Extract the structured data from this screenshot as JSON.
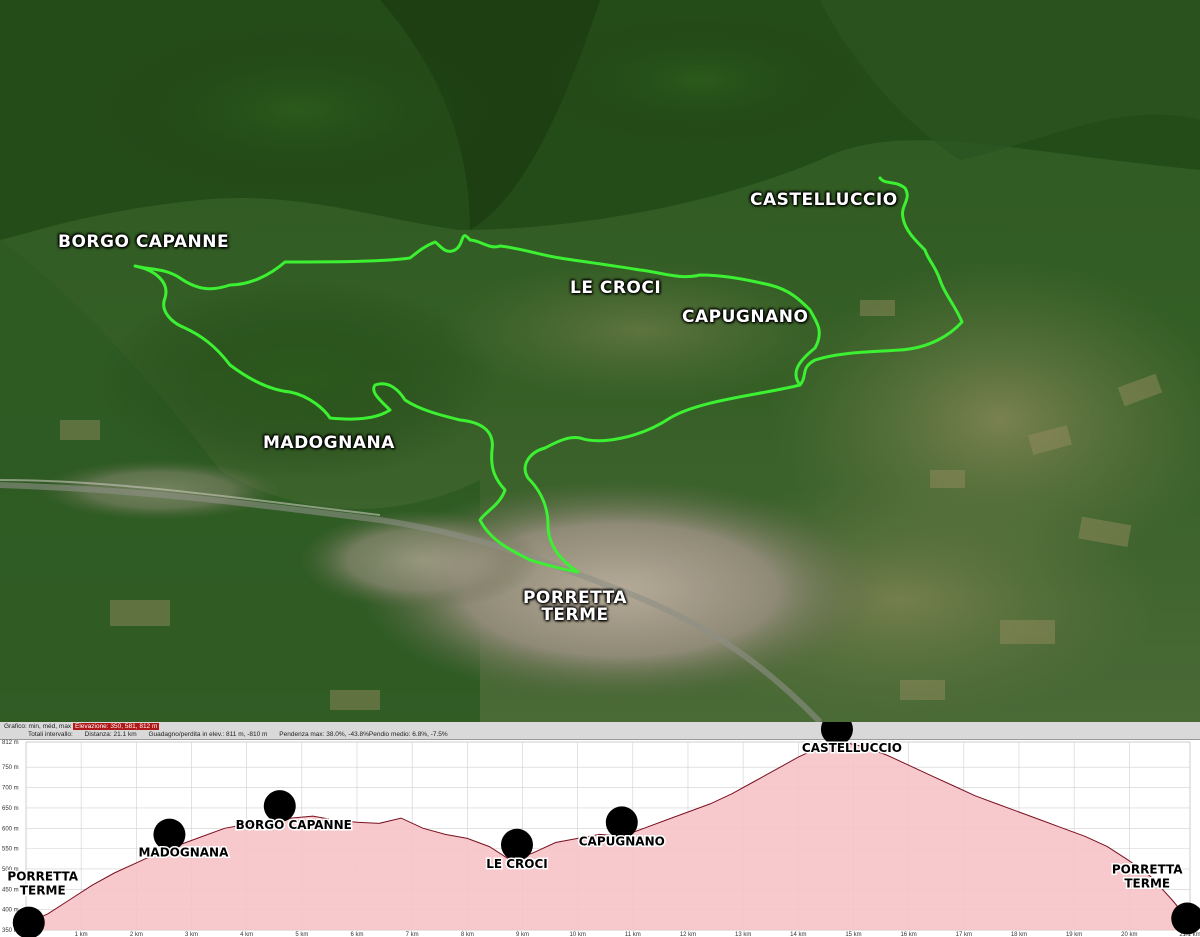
{
  "map": {
    "labels": {
      "borgo_capanne": "BORGO CAPANNE",
      "castelluccio": "CASTELLUCCIO",
      "le_croci": "LE CROCI",
      "capugnano": "CAPUGNANO",
      "madognana": "MADOGNANA",
      "porretta_line1": "PORRETTA",
      "porretta_line2": "TERME"
    },
    "colors": {
      "route": "#3cf032",
      "terrain_dark": "#1f3d14",
      "terrain_mid": "#3f6a28",
      "town": "#a69a86"
    }
  },
  "stats": {
    "row1_prefix": "Grafico: min, méd, max",
    "row1_elev": "Elevazione: 350, 581, 812 m",
    "row2_interval": "Totali intervallo:",
    "row2_distance": "Distanza: 21.1 km",
    "row2_gain": "Guadagno/perdita in elev.: 811 m, -810 m",
    "row2_slope": "Pendenza max: 38.0%, -43.8%",
    "row2_avg": "Pendio medio: 6.8%, -7.5%"
  },
  "chart_data": {
    "type": "area",
    "title": "",
    "xlabel": "",
    "ylabel": "",
    "xlim": [
      0,
      21.1
    ],
    "ylim": [
      350,
      812
    ],
    "x_tick_labels": [
      "0 m",
      "1 km",
      "2 km",
      "3 km",
      "4 km",
      "5 km",
      "6 km",
      "7 km",
      "8 km",
      "9 km",
      "10 km",
      "11 km",
      "12 km",
      "13 km",
      "14 km",
      "15 km",
      "16 km",
      "17 km",
      "18 km",
      "19 km",
      "20 km",
      "21.1 km"
    ],
    "y_tick_labels": [
      "812 m",
      "750 m",
      "700 m",
      "650 m",
      "600 m",
      "550 m",
      "500 m",
      "450 m",
      "400 m",
      "350 m"
    ],
    "x": [
      0,
      0.4,
      0.8,
      1.2,
      1.6,
      2.0,
      2.4,
      2.8,
      3.2,
      3.6,
      4.0,
      4.4,
      4.8,
      5.2,
      5.6,
      6.0,
      6.4,
      6.8,
      7.2,
      7.6,
      8.0,
      8.4,
      8.8,
      9.2,
      9.6,
      10.0,
      10.4,
      10.8,
      11.2,
      11.6,
      12.0,
      12.4,
      12.8,
      13.2,
      13.6,
      14.0,
      14.4,
      14.8,
      15.2,
      15.6,
      16.0,
      16.4,
      16.8,
      17.2,
      17.6,
      18.0,
      18.4,
      18.8,
      19.2,
      19.6,
      20.0,
      20.4,
      20.8,
      21.1
    ],
    "series": [
      {
        "values": [
          365,
          390,
          425,
          460,
          490,
          515,
          540,
          560,
          580,
          600,
          610,
          615,
          625,
          630,
          620,
          615,
          612,
          625,
          600,
          585,
          575,
          555,
          520,
          540,
          565,
          575,
          585,
          580,
          600,
          620,
          640,
          660,
          685,
          715,
          745,
          775,
          800,
          812,
          800,
          780,
          755,
          730,
          705,
          680,
          660,
          640,
          620,
          600,
          580,
          555,
          520,
          480,
          420,
          370
        ]
      }
    ],
    "waypoints": [
      {
        "name_line1": "PORRETTA",
        "name_line2": "TERME",
        "x": 0.05
      },
      {
        "name_line1": "MADOGNANA",
        "name_line2": "",
        "x": 2.6
      },
      {
        "name_line1": "BORGO CAPANNE",
        "name_line2": "",
        "x": 4.6
      },
      {
        "name_line1": "LE CROCI",
        "name_line2": "",
        "x": 8.9
      },
      {
        "name_line1": "CAPUGNANO",
        "name_line2": "",
        "x": 10.8
      },
      {
        "name_line1": "CASTELLUCCIO",
        "name_line2": "",
        "x": 14.7
      },
      {
        "name_line1": "PORRETTA",
        "name_line2": "TERME",
        "x": 21.05
      }
    ],
    "grid": true,
    "fill_color": "#f6c3c6",
    "line_color": "#7a1020"
  }
}
